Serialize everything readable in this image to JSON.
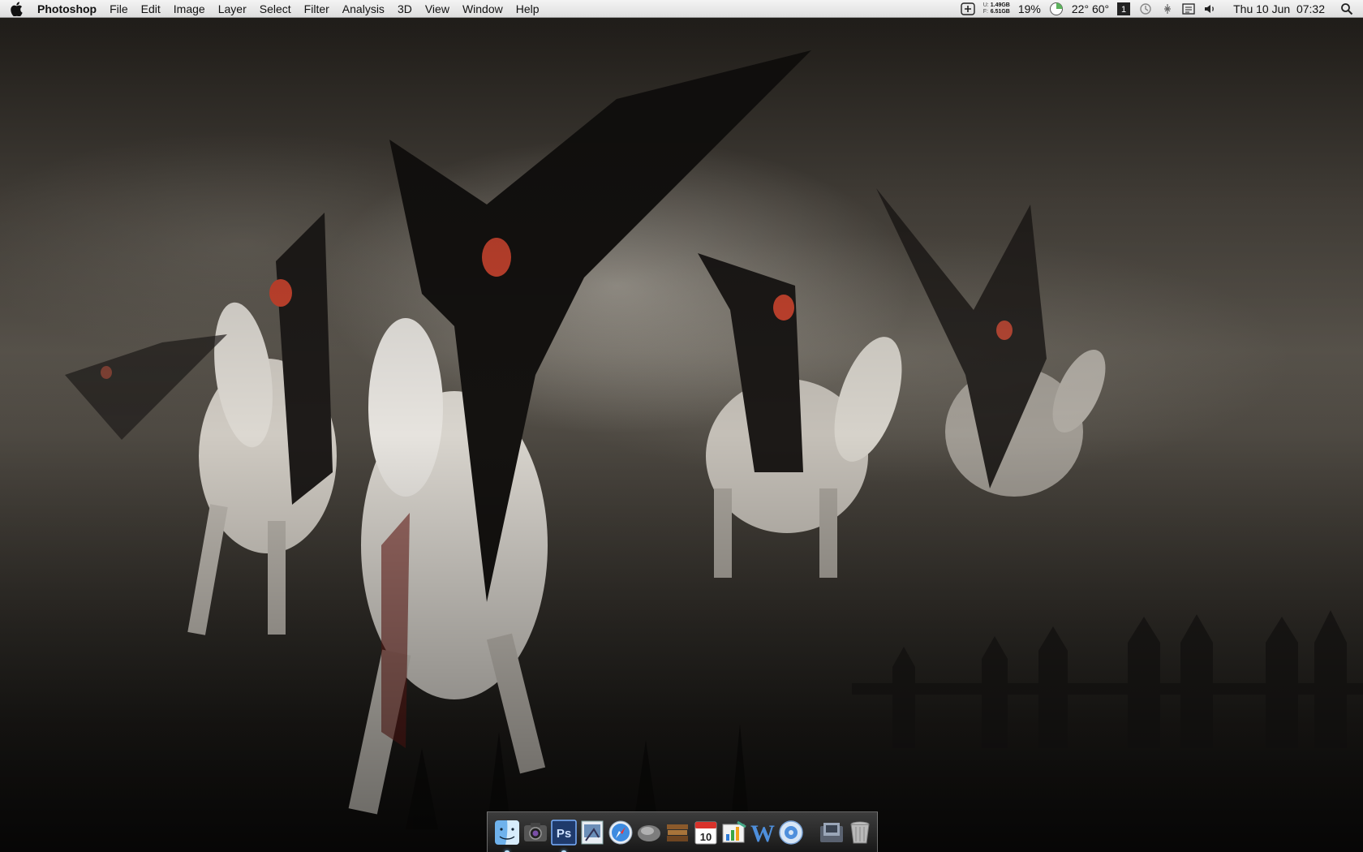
{
  "menubar": {
    "apple_icon": "apple-logo-icon",
    "app_name": "Photoshop",
    "menus": [
      "File",
      "Edit",
      "Image",
      "Layer",
      "Select",
      "Filter",
      "Analysis",
      "3D",
      "View",
      "Window",
      "Help"
    ],
    "status": {
      "disk_used_label": "U:",
      "disk_free_label": "F:",
      "disk_used": "1.49GB",
      "disk_free": "6.51GB",
      "cpu_percent": "19%",
      "temps": "22° 60°",
      "clock": "Thu 10 Jun  07:32"
    }
  },
  "dock": {
    "items": [
      {
        "name": "Finder",
        "icon": "finder-icon",
        "running": true
      },
      {
        "name": "Photo Booth",
        "icon": "camera-icon",
        "running": false
      },
      {
        "name": "Photoshop",
        "icon": "photoshop-icon",
        "label": "Ps",
        "running": true
      },
      {
        "name": "Preview",
        "icon": "preview-icon",
        "running": false
      },
      {
        "name": "Safari",
        "icon": "safari-compass-icon",
        "running": false
      },
      {
        "name": "Quicksilver",
        "icon": "quicksilver-icon",
        "running": false
      },
      {
        "name": "Delicious Library",
        "icon": "books-icon",
        "running": false
      },
      {
        "name": "iCal",
        "icon": "calendar-icon",
        "label": "10",
        "running": false
      },
      {
        "name": "Numbers",
        "icon": "chart-icon",
        "running": false
      },
      {
        "name": "Word",
        "icon": "word-icon",
        "label": "W",
        "running": false
      },
      {
        "name": "iTunes",
        "icon": "itunes-icon",
        "running": false
      },
      {
        "name": "Downloads",
        "icon": "downloads-stack-icon",
        "running": false
      },
      {
        "name": "Trash",
        "icon": "trash-icon",
        "running": false
      }
    ]
  }
}
